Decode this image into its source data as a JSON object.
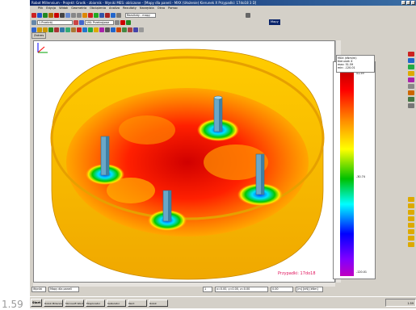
{
  "window": {
    "title": "Robot Millennium - Projekt: Grodk - zbiornik - Wyniki MES: obliczone - [Mapy dla paneli - MXX (Ułożenie) Kierunek X Przypadki: 17do18 3 D]"
  },
  "menu": [
    "Plik",
    "Edycja",
    "Widok",
    "Geometria",
    "Obciążenia",
    "Analiza",
    "Rezultaty",
    "Narzędzia",
    "Okno",
    "Pomoc"
  ],
  "toolbar": {
    "results_combo": "Rezultaty - mapy",
    "section_combo": "1 Przekrój",
    "layout_combo": "UKŁ Przekrojowe",
    "mode_box": "Mapy"
  },
  "view": {
    "tab": "Zakres",
    "caption": "Przypadki: 17do18"
  },
  "legend": {
    "header_lines": [
      "MXX (kNm/m)",
      "Kierunek X",
      "max: 51.59",
      "min: -120.01"
    ],
    "values": [
      "51.59",
      "-30.74",
      "-120.01"
    ]
  },
  "status": {
    "fields": [
      "Wyniki",
      "Mapy dla paneli",
      "1",
      "x=0.00, y=0.00, z=0.00",
      "0.00",
      "[m] [kN] [kNm]"
    ]
  },
  "taskbar": {
    "start": "Start",
    "tasks": [
      "Robot Millennium",
      "Microsoft Word",
      "Eksplorator",
      "Kalkulator",
      "Paint",
      "Robot"
    ],
    "clock": "1:59"
  },
  "page": {
    "number": "1.59"
  },
  "colors": {
    "title_bar": "#0a246a",
    "caption": "#e0105a",
    "ring": "#f5b800",
    "max": "#b00000",
    "min": "#0000ff"
  },
  "icons": {
    "toolbar": [
      "new-icon",
      "open-icon",
      "save-icon",
      "print-icon",
      "cut-icon",
      "copy-icon",
      "paste-icon",
      "undo-icon",
      "redo-icon",
      "zoom-icon",
      "rotate-icon",
      "view-3d-icon",
      "select-icon",
      "measure-icon"
    ],
    "right": [
      "node-icon",
      "bar-icon",
      "panel-icon",
      "support-icon",
      "load-icon",
      "result-icon",
      "map-icon",
      "table-icon",
      "help-icon"
    ]
  }
}
